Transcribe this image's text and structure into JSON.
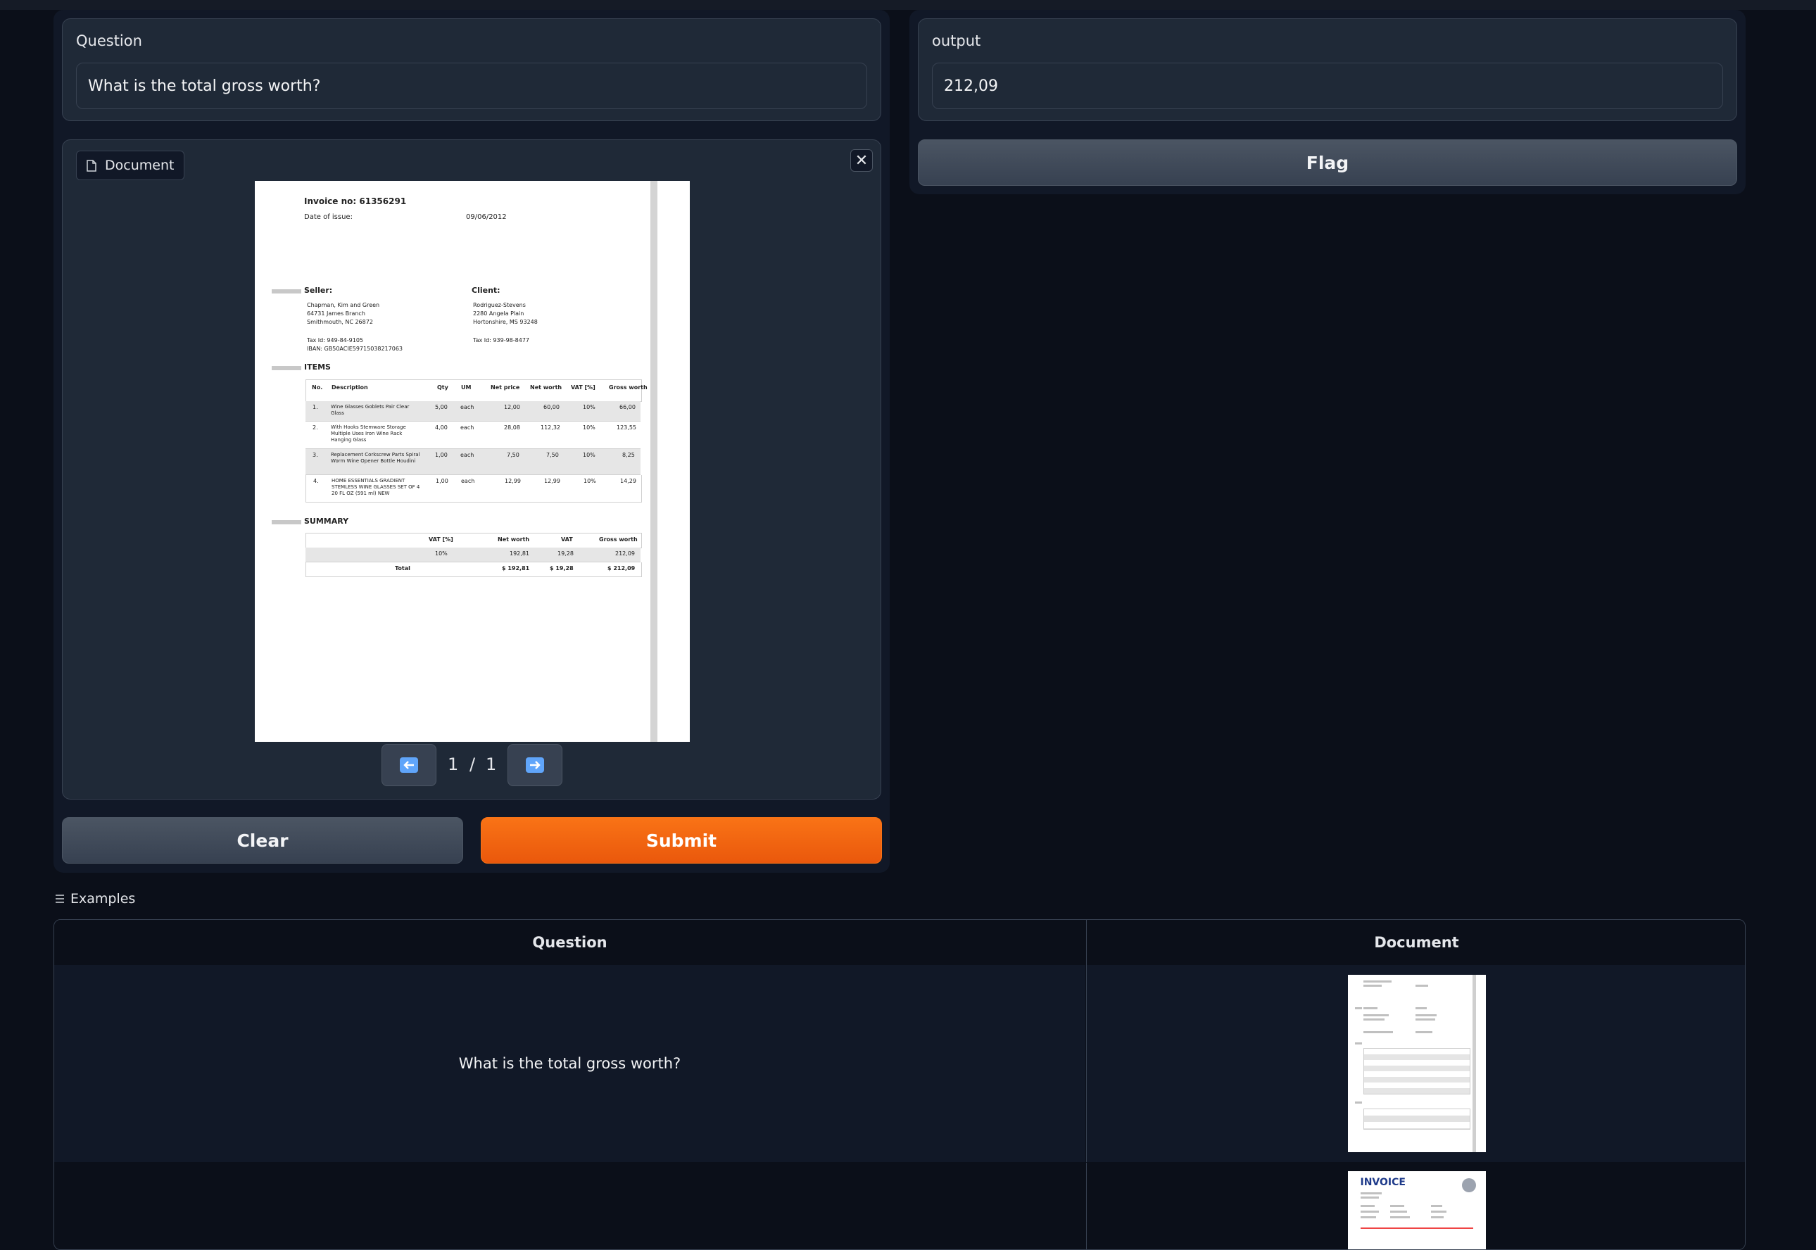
{
  "question": {
    "label": "Question",
    "value": "What is the total gross worth?"
  },
  "output": {
    "label": "output",
    "value": "212,09"
  },
  "flag_label": "Flag",
  "document": {
    "label": "Document",
    "close_glyph": "✕",
    "page_current": "1",
    "page_sep": "/",
    "page_total": "1",
    "invoice": {
      "title": "Invoice no: 61356291",
      "date_label": "Date of issue:",
      "date_value": "09/06/2012",
      "seller_heading": "Seller:",
      "client_heading": "Client:",
      "seller_lines": [
        "Chapman, Kim and Green",
        "64731 James Branch",
        "Smithmouth, NC 26872"
      ],
      "client_lines": [
        "Rodriguez-Stevens",
        "2280 Angela Plain",
        "Hortonshire, MS 93248"
      ],
      "seller_tax": "Tax Id: 949-84-9105",
      "seller_iban": "IBAN: GB50ACIE59715038217063",
      "client_tax": "Tax Id: 939-98-8477",
      "items_heading": "ITEMS",
      "item_headers": [
        "No.",
        "Description",
        "Qty",
        "UM",
        "Net price",
        "Net worth",
        "VAT [%]",
        "Gross worth"
      ],
      "items": [
        [
          "1.",
          "Wine Glasses Goblets Pair Clear Glass",
          "5,00",
          "each",
          "12,00",
          "60,00",
          "10%",
          "66,00"
        ],
        [
          "2.",
          "With Hooks Stemware Storage Multiple Uses Iron Wine Rack Hanging Glass",
          "4,00",
          "each",
          "28,08",
          "112,32",
          "10%",
          "123,55"
        ],
        [
          "3.",
          "Replacement Corkscrew Parts Spiral Worm Wine Opener Bottle Houdini",
          "1,00",
          "each",
          "7,50",
          "7,50",
          "10%",
          "8,25"
        ],
        [
          "4.",
          "HOME ESSENTIALS GRADIENT STEMLESS WINE GLASSES SET OF 4 20 FL OZ (591 ml) NEW",
          "1,00",
          "each",
          "12,99",
          "12,99",
          "10%",
          "14,29"
        ]
      ],
      "summary_heading": "SUMMARY",
      "summary_headers": [
        "VAT [%]",
        "Net worth",
        "VAT",
        "Gross worth"
      ],
      "summary_row": [
        "10%",
        "192,81",
        "19,28",
        "212,09"
      ],
      "total_label": "Total",
      "total_row": [
        "$ 192,81",
        "$ 19,28",
        "$ 212,09"
      ]
    }
  },
  "clear_label": "Clear",
  "submit_label": "Submit",
  "examples": {
    "label": "Examples",
    "headers": [
      "Question",
      "Document"
    ],
    "rows": [
      {
        "question": "What is the total gross worth?"
      },
      {
        "question": "",
        "thumb_title": "INVOICE"
      }
    ]
  }
}
